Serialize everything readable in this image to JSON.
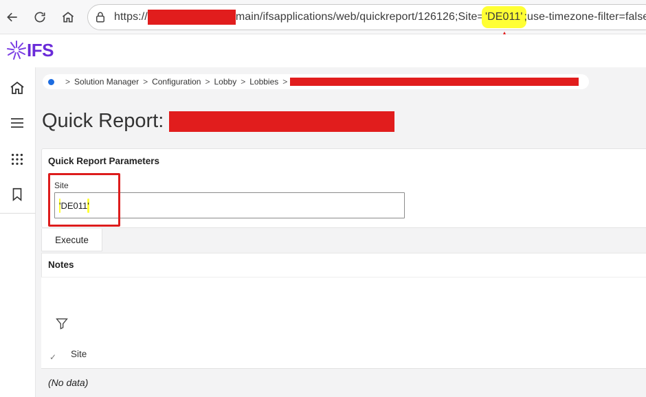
{
  "browser": {
    "url_prefix": "https://",
    "url_main": "main/ifsapplications/web/quickreport/126126;Site=",
    "url_param_value": "'DE011'",
    "url_suffix": ";use-timezone-filter=false;"
  },
  "app": {
    "logo_text": "IFS",
    "logo_color": "#6a2bd9"
  },
  "breadcrumb": {
    "items": [
      "Solution Manager",
      "Configuration",
      "Lobby",
      "Lobbies"
    ],
    "separator": ">"
  },
  "page": {
    "title": "Quick Report:"
  },
  "params_panel": {
    "title": "Quick Report Parameters",
    "site_label": "Site",
    "site_value_open_quote": "'",
    "site_value": "DE011",
    "site_value_close_quote": "'"
  },
  "actions": {
    "execute_label": "Execute"
  },
  "notes": {
    "title": "Notes",
    "columns": [
      "Site"
    ],
    "check_glyph": "✓",
    "empty_text": "(No data)"
  },
  "annotations": {
    "highlight_color": "#ffff33",
    "marker_color": "#dd1c1c"
  },
  "icons": [
    "back-arrow-icon",
    "reload-icon",
    "home-icon",
    "lock-icon",
    "ifs-logo-icon",
    "rail-home-icon",
    "menu-icon",
    "apps-grid-icon",
    "bookmark-icon",
    "filter-icon",
    "checkmark-icon"
  ]
}
